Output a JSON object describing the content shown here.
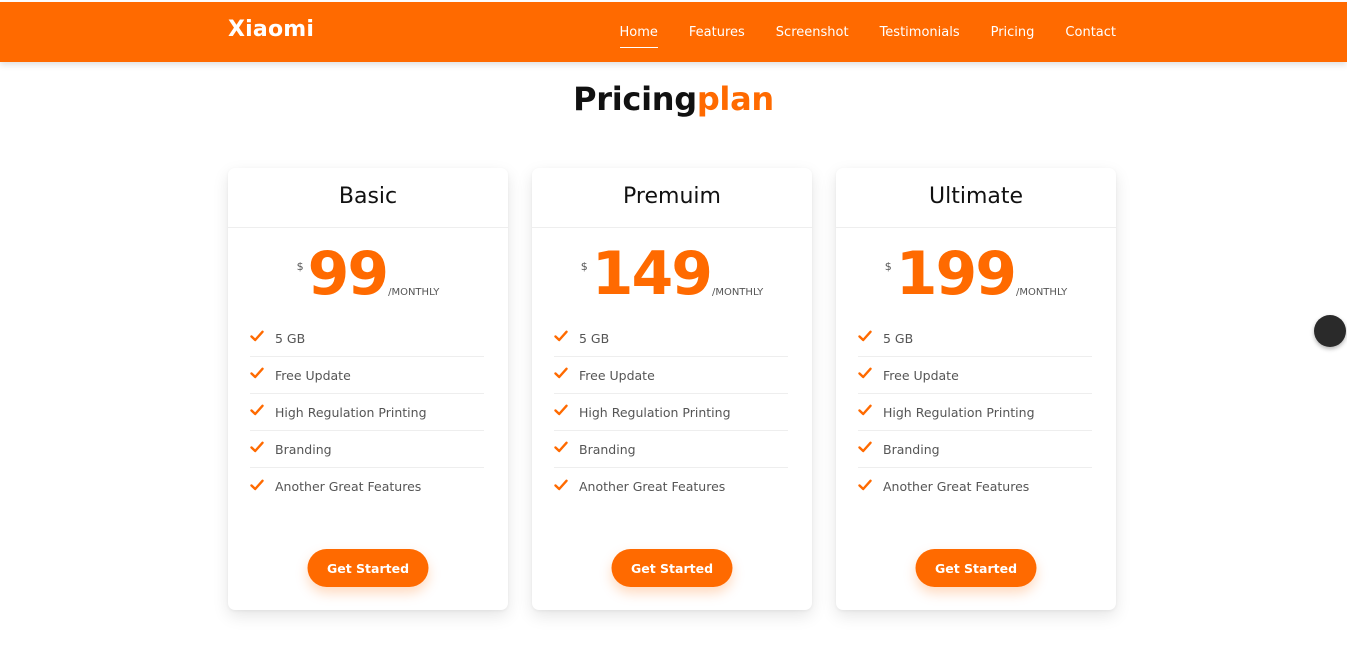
{
  "brand": {
    "name": "Xiaomi"
  },
  "nav": {
    "items": [
      {
        "label": "Home",
        "active": true
      },
      {
        "label": "Features",
        "active": false
      },
      {
        "label": "Screenshot",
        "active": false
      },
      {
        "label": "Testimonials",
        "active": false
      },
      {
        "label": "Pricing",
        "active": false
      },
      {
        "label": "Contact",
        "active": false
      }
    ]
  },
  "section": {
    "title_main": "Pricing",
    "title_accent": "plan"
  },
  "plans": [
    {
      "name": "Basic",
      "currency": "$",
      "price": "99",
      "period": "/MONTHLY",
      "features": [
        "5 GB",
        "Free Update",
        "High Regulation Printing",
        "Branding",
        "Another Great Features"
      ],
      "cta": "Get Started"
    },
    {
      "name": "Premuim",
      "currency": "$",
      "price": "149",
      "period": "/MONTHLY",
      "features": [
        "5 GB",
        "Free Update",
        "High Regulation Printing",
        "Branding",
        "Another Great Features"
      ],
      "cta": "Get Started"
    },
    {
      "name": "Ultimate",
      "currency": "$",
      "price": "199",
      "period": "/MONTHLY",
      "features": [
        "5 GB",
        "Free Update",
        "High Regulation Printing",
        "Branding",
        "Another Great Features"
      ],
      "cta": "Get Started"
    }
  ],
  "colors": {
    "accent": "#ff6a00",
    "text_dark": "#111111",
    "text_muted": "#555555"
  },
  "icons": {
    "feature": "check-icon",
    "scroll": "scroll-to-top-button"
  }
}
